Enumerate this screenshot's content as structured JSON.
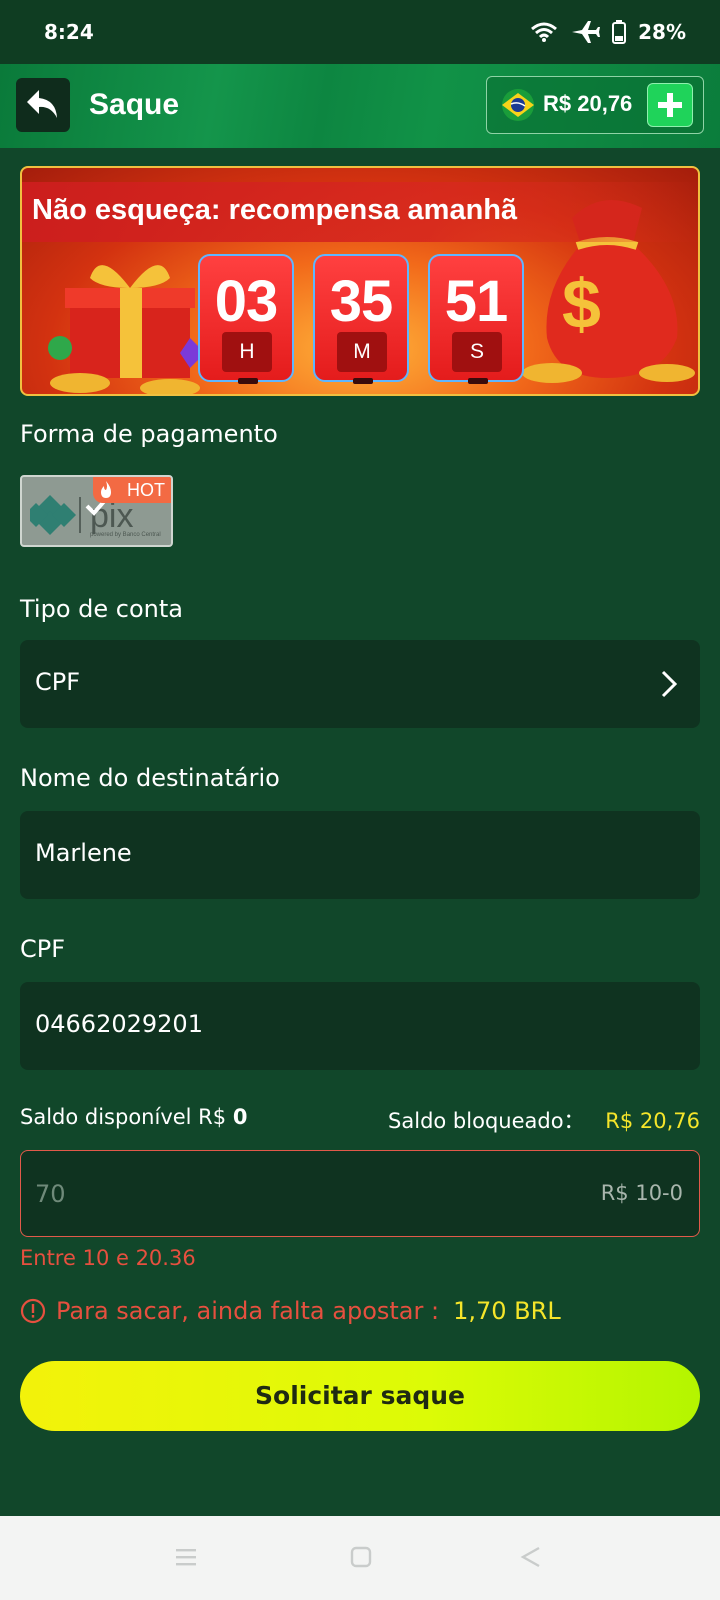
{
  "status_bar": {
    "time": "8:24",
    "battery": "28%",
    "icons": [
      "wifi-icon",
      "airplane-icon",
      "battery-icon"
    ]
  },
  "header": {
    "title": "Saque",
    "balance": "R$ 20,76",
    "icons": [
      "back-arrow-icon",
      "brazil-flag-icon",
      "plus-icon"
    ]
  },
  "banner": {
    "title": "Não esqueça: recompensa amanhã",
    "timer": [
      {
        "value": "03",
        "unit": "H"
      },
      {
        "value": "35",
        "unit": "M"
      },
      {
        "value": "51",
        "unit": "S"
      }
    ]
  },
  "payment": {
    "label": "Forma de pagamento",
    "method_badge": "HOT",
    "method_logo_text": "pix",
    "method_logo_subtext": "powered by Banco Central"
  },
  "account_type": {
    "label": "Tipo de conta",
    "value": "CPF"
  },
  "recipient": {
    "label": "Nome do destinatário",
    "value": "Marlene"
  },
  "cpf": {
    "label": "CPF",
    "value": "04662029201"
  },
  "saldo": {
    "available_label": "Saldo disponível R$",
    "available_value": "0",
    "blocked_label": "Saldo bloqueado：",
    "blocked_value": "R$ 20,76"
  },
  "amount": {
    "placeholder": "70",
    "range_hint": "R$ 10-0",
    "error": "Entre 10 e 20.36"
  },
  "warning": {
    "text": "Para sacar, ainda falta apostar :",
    "amount": "1,70 BRL"
  },
  "submit_label": "Solicitar saque",
  "colors": {
    "background": "#11472a",
    "header": "#0d8641",
    "field": "#0f3320",
    "accent_yellow": "#f5e52a",
    "error_red": "#e6503f",
    "button": "#dcfb06"
  }
}
